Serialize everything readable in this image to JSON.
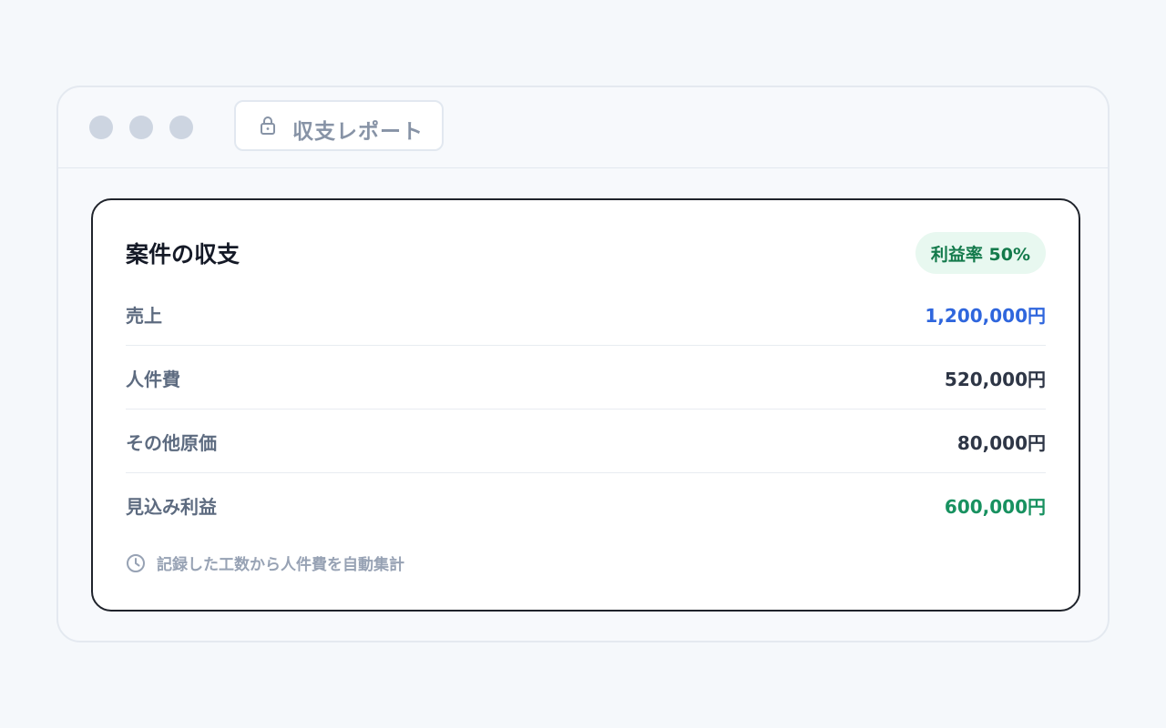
{
  "window": {
    "tab_title": "収支レポート",
    "lock_icon": "lock-icon"
  },
  "card": {
    "title": "案件の収支",
    "badge": "利益率 50%",
    "rows": [
      {
        "label": "売上",
        "value": "1,200,000円",
        "color": "#2f66dd"
      },
      {
        "label": "人件費",
        "value": "520,000円",
        "color": "#2e3646"
      },
      {
        "label": "その他原価",
        "value": "80,000円",
        "color": "#2e3646"
      },
      {
        "label": "見込み利益",
        "value": "600,000円",
        "color": "#189160"
      }
    ],
    "note": "記録した工数から人件費を自動集計",
    "note_icon": "clock-icon"
  },
  "colors": {
    "accent_blue": "#2f66dd",
    "accent_green": "#189160",
    "badge_bg": "#e8f8f0"
  }
}
